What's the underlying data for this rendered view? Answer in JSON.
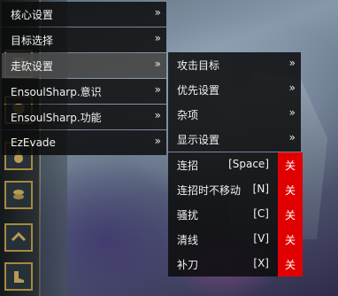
{
  "main_menu": {
    "items": [
      {
        "label": "核心设置",
        "arrow": "»"
      },
      {
        "label": "目标选择",
        "arrow": "»"
      },
      {
        "label": "走砍设置",
        "arrow": "»"
      },
      {
        "label": "EnsoulSharp.意识",
        "arrow": "»"
      },
      {
        "label": "EnsoulSharp.功能",
        "arrow": "»"
      },
      {
        "label": "EzEvade",
        "arrow": "»"
      }
    ],
    "active_index": 2
  },
  "orbwalker_menu": {
    "items": [
      {
        "label": "攻击目标",
        "arrow": "»"
      },
      {
        "label": "优先设置",
        "arrow": "»"
      },
      {
        "label": "杂项",
        "arrow": "»"
      },
      {
        "label": "显示设置",
        "arrow": "»"
      }
    ]
  },
  "keys_menu": {
    "items": [
      {
        "label": "连招",
        "key": "[Space]",
        "state": "关"
      },
      {
        "label": "连招时不移动",
        "key": "[N]",
        "state": "关"
      },
      {
        "label": "骚扰",
        "key": "[C]",
        "state": "关"
      },
      {
        "label": "清线",
        "key": "[V]",
        "state": "关"
      },
      {
        "label": "补刀",
        "key": "[X]",
        "state": "关"
      }
    ]
  },
  "sidebar_icons": [
    "scroll-icon",
    "shield-icon",
    "potion-icon",
    "coins-icon",
    "chevron-up-icon",
    "boots-icon"
  ],
  "colors": {
    "toggle_off": "#e10000",
    "menu_bg": "#0c0c0c",
    "active_bg": "#464646",
    "frame_gold": "#a7893f"
  }
}
